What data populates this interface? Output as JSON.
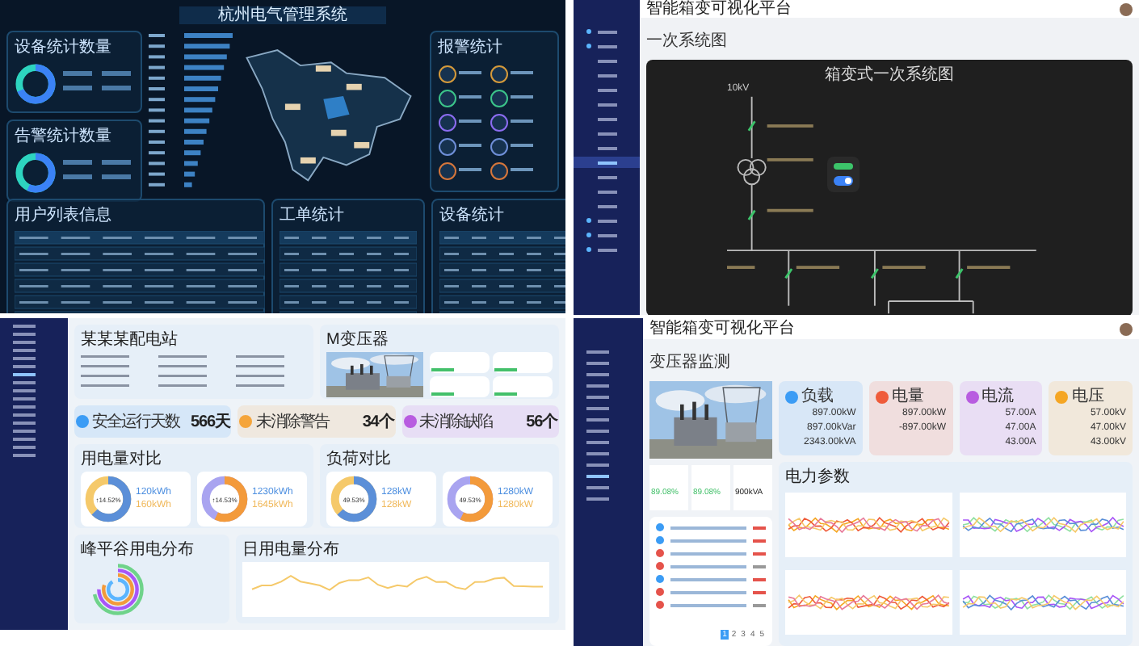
{
  "screen_dark": {
    "title": "杭州电气管理系统",
    "device_panel": "设备统计数量",
    "alarm_count_panel": "告警统计数量",
    "alarm_panel": "报警统计",
    "users_panel": "用户列表信息",
    "orders_panel": "工单统计",
    "equipment_panel": "设备统计"
  },
  "screen_diagram": {
    "brand": "智能箱变可视化平台",
    "page_title": "一次系统图",
    "diagram_title": "箱变式一次系统图",
    "bus_label": "10kV",
    "switch": {
      "on": true
    },
    "menu": [
      {
        "selected": false
      },
      {
        "selected": false
      },
      {
        "selected": false
      },
      {
        "selected": false
      },
      {
        "selected": false
      },
      {
        "selected": false
      },
      {
        "selected": false
      },
      {
        "selected": false
      },
      {
        "selected": false
      },
      {
        "selected": true
      },
      {
        "selected": false
      },
      {
        "selected": false
      },
      {
        "selected": false
      },
      {
        "selected": false
      },
      {
        "selected": false
      },
      {
        "selected": false
      }
    ]
  },
  "screen_station": {
    "station": "某某某配电站",
    "transformer": "M变压器",
    "stats": [
      {
        "label": "安全运行天数",
        "value": "566天",
        "color": "#3b9cf5"
      },
      {
        "label": "未消除警告",
        "value": "34个",
        "color": "#f5a53b"
      },
      {
        "label": "未消除缺陷",
        "value": "56个",
        "color": "#b85ce0"
      }
    ],
    "usage": {
      "title": "用电量对比",
      "donuts": [
        {
          "center": "↑14.52%",
          "values": [
            "120kWh",
            "160kWh"
          ]
        },
        {
          "center": "↑14.53%",
          "values": [
            "1230kWh",
            "1645kWh"
          ]
        }
      ]
    },
    "load": {
      "title": "负荷对比",
      "donuts": [
        {
          "center": "49.53%",
          "values": [
            "128kW",
            "128kW"
          ]
        },
        {
          "center": "49.53%",
          "values": [
            "1280kW",
            "1280kW"
          ]
        }
      ]
    },
    "peak_title": "峰平谷用电分布",
    "daily_title": "日用电量分布"
  },
  "screen_monitor": {
    "brand": "智能箱变可视化平台",
    "page_title": "变压器监测",
    "metrics": [
      {
        "label": "负载",
        "color": "#3b9cf5",
        "values": [
          "897.00kW",
          "897.00kVar",
          "2343.00kVA"
        ]
      },
      {
        "label": "电量",
        "color": "#ef5b3a",
        "values": [
          "897.00kW",
          "-897.00kW"
        ]
      },
      {
        "label": "电流",
        "color": "#b85ce0",
        "values": [
          "57.00A",
          "47.00A",
          "43.00A"
        ]
      },
      {
        "label": "电压",
        "color": "#f5a623",
        "values": [
          "57.00kV",
          "47.00kV",
          "43.00kV"
        ]
      }
    ],
    "summary": [
      "89.08%",
      "89.08%",
      "900kVA"
    ],
    "params_title": "电力参数",
    "alarms": [
      {
        "color": "#3b9cf5"
      },
      {
        "color": "#3b9cf5"
      },
      {
        "color": "#e5534b"
      },
      {
        "color": "#e5534b"
      },
      {
        "color": "#3b9cf5"
      },
      {
        "color": "#e5534b"
      },
      {
        "color": "#e5534b"
      }
    ],
    "pages": [
      {
        "label": "1",
        "selected": true
      },
      {
        "label": "2",
        "selected": false
      },
      {
        "label": "3",
        "selected": false
      },
      {
        "label": "4",
        "selected": false
      },
      {
        "label": "5",
        "selected": false
      }
    ]
  }
}
